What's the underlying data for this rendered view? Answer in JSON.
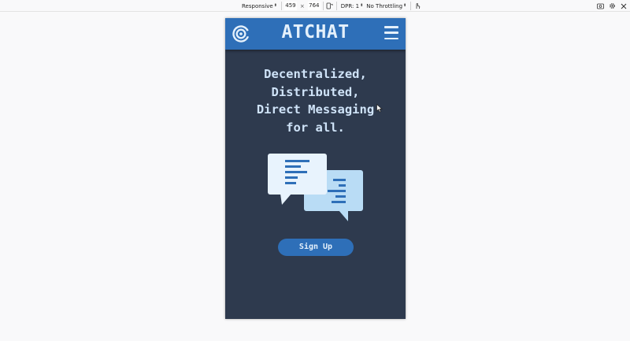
{
  "devtools": {
    "device": "Responsive",
    "width": "459",
    "times": "×",
    "height": "764",
    "dpr": "DPR: 1",
    "throttling": "No Throttling",
    "icons": [
      "rotate-icon",
      "touch-icon",
      "screenshot-icon",
      "settings-icon",
      "close-icon"
    ]
  },
  "app": {
    "title": "ATCHAT",
    "logo_icon": "at-sign-icon",
    "menu_icon": "hamburger-menu-icon",
    "hero_lines": [
      "Decentralized,",
      "Distributed,",
      "Direct Messaging",
      "for all."
    ],
    "illustration_icon": "chat-bubbles-icon",
    "signup_label": "Sign Up"
  },
  "colors": {
    "header": "#2e6fb8",
    "background": "#2e3a4e",
    "hero_text": "#cfe3f8",
    "bubble_light": "#e8f3fd",
    "bubble_blue": "#b9dcf5",
    "bubble_lines": "#2e6fb8"
  }
}
